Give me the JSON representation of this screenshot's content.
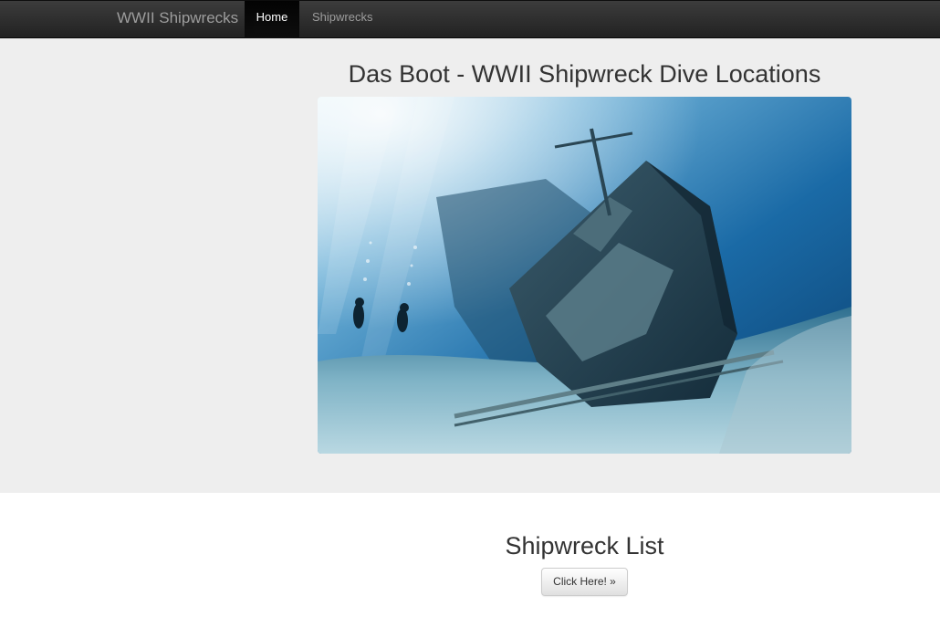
{
  "navbar": {
    "brand": "WWII Shipwrecks",
    "items": [
      {
        "label": "Home",
        "active": true
      },
      {
        "label": "Shipwrecks",
        "active": false
      }
    ]
  },
  "hero": {
    "title": "Das Boot - WWII Shipwreck Dive Locations",
    "image_alt": "underwater shipwreck with divers"
  },
  "section": {
    "title": "Shipwreck List",
    "button_label": "Click Here! »"
  },
  "colors": {
    "navbar_bg": "#222222",
    "jumbotron_bg": "#eeeeee",
    "water_top": "#cfe8f2",
    "water_deep": "#0d4f86"
  }
}
